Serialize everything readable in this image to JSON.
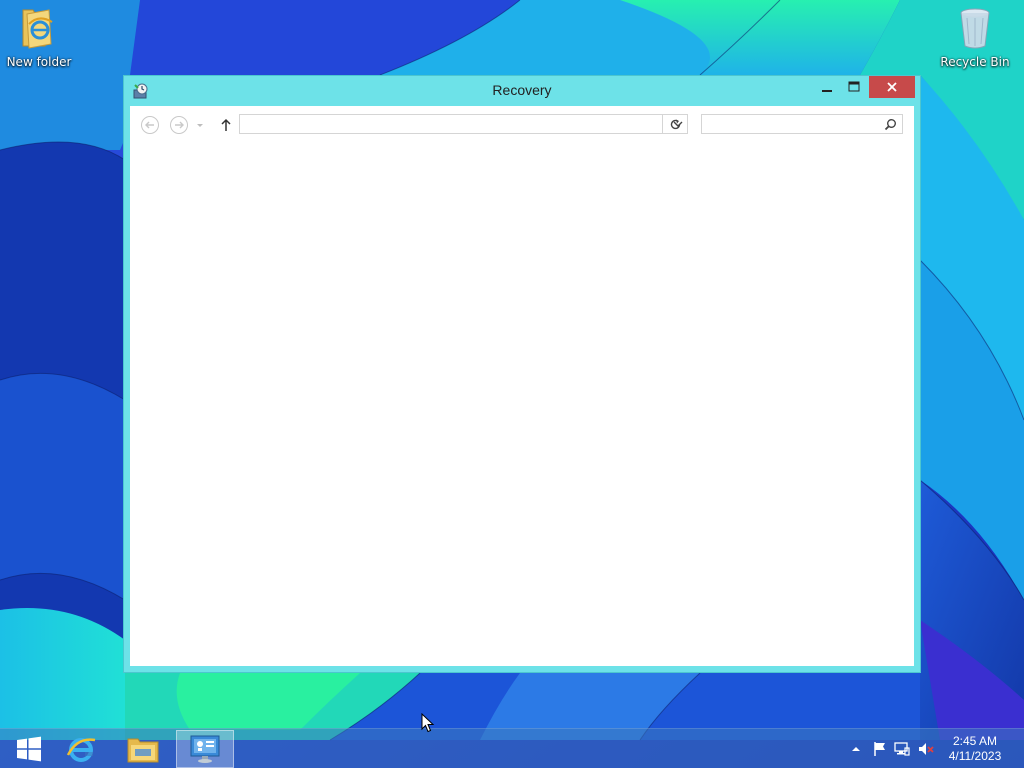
{
  "desktop": {
    "icons": [
      {
        "label": "New folder",
        "icon": "folder-ie-icon"
      },
      {
        "label": "Recycle Bin",
        "icon": "recycle-bin-icon"
      }
    ]
  },
  "window": {
    "title": "Recovery",
    "app_icon": "recovery-icon",
    "controls": {
      "minimize": "minimize-icon",
      "maximize": "maximize-icon",
      "close": "close-icon"
    },
    "navigation": {
      "back": "back-arrow-icon",
      "forward": "forward-arrow-icon",
      "recent": "chevron-down-icon",
      "up": "up-arrow-icon",
      "address_value": "",
      "refresh": "refresh-icon",
      "search_value": "",
      "search_placeholder": ""
    }
  },
  "taskbar": {
    "items": [
      {
        "name": "start",
        "icon": "windows-logo-icon"
      },
      {
        "name": "internet-explorer",
        "icon": "ie-icon"
      },
      {
        "name": "file-explorer",
        "icon": "folder-icon"
      },
      {
        "name": "control-panel",
        "icon": "control-panel-icon",
        "active": true
      }
    ],
    "tray": {
      "icons": [
        "show-hidden-icon",
        "action-center-flag-icon",
        "network-icon",
        "speaker-muted-icon"
      ]
    },
    "clock": {
      "time": "2:45 AM",
      "date": "4/11/2023"
    }
  },
  "colors": {
    "window_frame": "#6de2e8",
    "close_button": "#c74a4a",
    "taskbar": "#3c78be"
  }
}
